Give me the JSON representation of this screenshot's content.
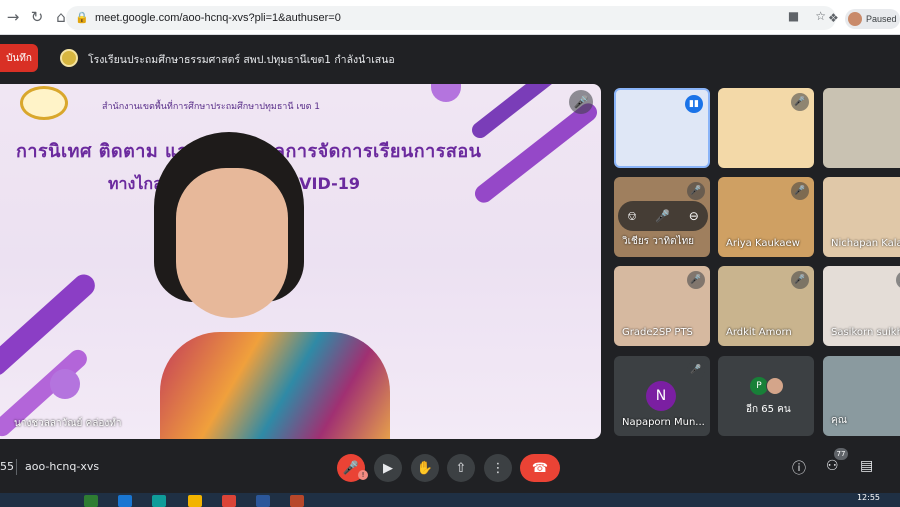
{
  "browser": {
    "url": "meet.google.com/aoo-hcnq-xvs?pli=1&authuser=0",
    "paused_label": "Paused"
  },
  "banner": {
    "record_label": "บันทึก",
    "presenter_text": "โรงเรียนประถมศึกษาธรรมศาสตร์ สพป.ปทุมธานีเขต1 กำลังนำเสนอ"
  },
  "stage": {
    "office_text": "สำนักงานเขตพื้นที่การศึกษาประถมศึกษาปทุมธานี เขต 1",
    "slide_title": "การนิเทศ ติดตาม และประเมินผลการจัดการเรียนการสอน",
    "slide_subtitle": "ทางไกล ในสถานการณ์ COVID-19",
    "speaker_name": "นางชวลลาวัณย์ คล่องทำ"
  },
  "tiles": [
    {
      "name": ""
    },
    {
      "name": ""
    },
    {
      "name": ""
    },
    {
      "name": "วิเชียร วาทิตไทย"
    },
    {
      "name": "Ariya Kaukaew"
    },
    {
      "name": "Nichapan Kala"
    },
    {
      "name": "Grade2SP PTS"
    },
    {
      "name": "Ardkit Amorn"
    },
    {
      "name": "Sasikorn suikh"
    },
    {
      "name": "Napaporn Mun..."
    },
    {
      "name": "อีก 65 คน"
    },
    {
      "name": "คุณ"
    }
  ],
  "avatars": {
    "n_initial": "N",
    "p_initial": "P"
  },
  "toolbar": {
    "time": "55",
    "meeting_code": "aoo-hcnq-xvs",
    "people_count": "77"
  },
  "taskbar": {
    "clock": "12:55"
  }
}
